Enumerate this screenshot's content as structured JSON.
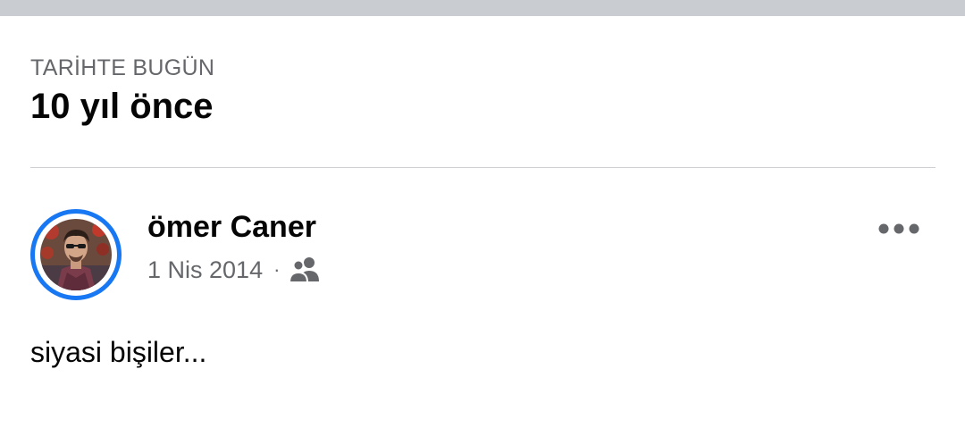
{
  "status_bar": {
    "color": "#c9ccd1"
  },
  "memories": {
    "section_label": "TARİHTE BUGÜN",
    "title": "10 yıl önce"
  },
  "post": {
    "author": "ömer Caner",
    "date": "1 Nis 2014",
    "separator": "·",
    "audience_icon": "friends-icon",
    "more_icon": "more-options-icon",
    "text": "siyasi bişiler...",
    "avatar_ring_color": "#1877f2"
  }
}
